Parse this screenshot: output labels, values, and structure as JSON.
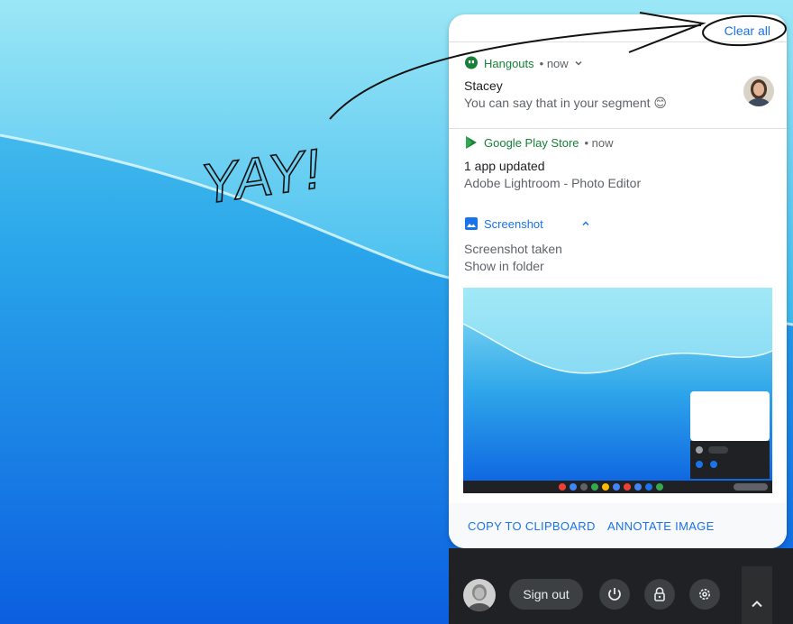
{
  "annotation_text": "YAY!",
  "notifications": {
    "clear_all": "Clear all",
    "hangouts": {
      "app": "Hangouts",
      "meta": "• now",
      "title": "Stacey",
      "body": "You can say that in your segment 😊"
    },
    "playstore": {
      "app": "Google Play Store",
      "meta": "• now",
      "title": "1 app updated",
      "body": "Adobe Lightroom - Photo Editor"
    },
    "screenshot": {
      "app": "Screenshot",
      "title": "Screenshot taken",
      "body": "Show in folder",
      "copy_label": "COPY TO CLIPBOARD",
      "annotate_label": "ANNOTATE IMAGE"
    }
  },
  "shelf": {
    "signout_label": "Sign out"
  },
  "colors": {
    "accent": "#1a73e8",
    "app_green": "#188038",
    "shelf_bg": "#202124"
  },
  "icons": [
    "hangouts-icon",
    "chevron-down-icon",
    "play-store-icon",
    "screenshot-icon",
    "chevron-up-icon",
    "power-icon",
    "lock-icon",
    "gear-icon"
  ]
}
